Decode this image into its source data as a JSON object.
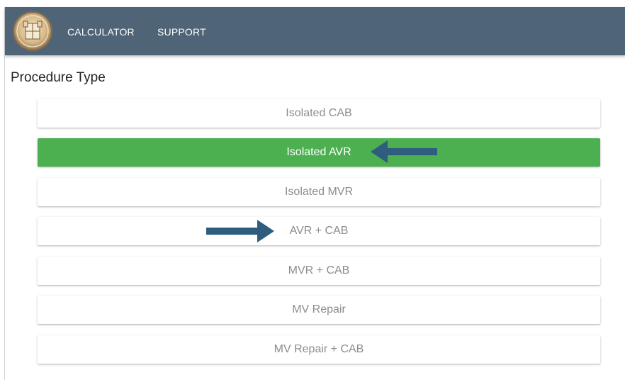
{
  "navbar": {
    "logo_icon": "institution-seal-icon",
    "links": [
      "CALCULATOR",
      "SUPPORT"
    ],
    "background": "#4f6476"
  },
  "section": {
    "title": "Procedure Type"
  },
  "options": [
    {
      "label": "Isolated CAB",
      "selected": false
    },
    {
      "label": "Isolated AVR",
      "selected": true
    },
    {
      "label": "Isolated MVR",
      "selected": false
    },
    {
      "label": "AVR + CAB",
      "selected": false
    },
    {
      "label": "MVR + CAB",
      "selected": false
    },
    {
      "label": "MV Repair",
      "selected": false
    },
    {
      "label": "MV Repair + CAB",
      "selected": false
    }
  ],
  "colors": {
    "selected": "#4caf50",
    "annotation_arrow": "#2f5d7e"
  },
  "annotations": [
    {
      "icon": "arrow-left-icon",
      "points_to": "Isolated AVR"
    },
    {
      "icon": "arrow-right-icon",
      "points_to": "AVR + CAB"
    }
  ]
}
